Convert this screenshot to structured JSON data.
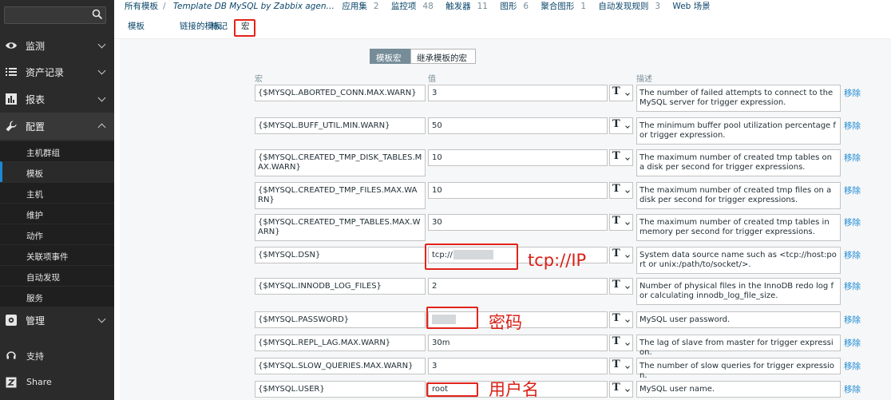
{
  "sidebar": {
    "search": {
      "value": "",
      "placeholder": ""
    },
    "menu": [
      {
        "label": "监测"
      },
      {
        "label": "资产记录"
      },
      {
        "label": "报表"
      },
      {
        "label": "配置"
      },
      {
        "label": "管理"
      }
    ],
    "config_submenu": [
      "主机群组",
      "模板",
      "主机",
      "维护",
      "动作",
      "关联项事件",
      "自动发现",
      "服务"
    ],
    "bottom": [
      {
        "label": "支持"
      },
      {
        "label": "Share"
      }
    ]
  },
  "breadcrumb": {
    "all_templates": "所有模板",
    "separator": "/",
    "template_name": "Template DB MySQL by Zabbix agen…",
    "applications": "应用集",
    "applications_count": "2",
    "items": "监控项",
    "items_count": "48",
    "triggers": "触发器",
    "triggers_count": "11",
    "graphs": "图形",
    "graphs_count": "6",
    "aggregate_graphs": "聚合图形",
    "aggregate_graphs_count": "1",
    "discovery": "自动发现规则",
    "discovery_count": "3",
    "web": "Web 场景"
  },
  "tabs": [
    "模板",
    "链接的模板",
    "标记",
    "宏"
  ],
  "subtabs": {
    "template_macros": "模板宏",
    "inherited_macros": "继承模板的宏"
  },
  "columns": {
    "macro": "宏",
    "value": "值",
    "description": "描述"
  },
  "remove_label": "移除",
  "macros": [
    {
      "macro": "{$MYSQL.ABORTED_CONN.MAX.WARN}",
      "value": "3",
      "description": "The number of failed attempts to connect to the MySQL server for trigger expression."
    },
    {
      "macro": "{$MYSQL.BUFF_UTIL.MIN.WARN}",
      "value": "50",
      "description": "The minimum buffer pool utilization percentage for trigger expression."
    },
    {
      "macro": "{$MYSQL.CREATED_TMP_DISK_TABLES.MAX.WARN}",
      "value": "10",
      "description": "The maximum number of created tmp tables on a disk per second for trigger expressions."
    },
    {
      "macro": "{$MYSQL.CREATED_TMP_FILES.MAX.WARN}",
      "value": "10",
      "description": "The maximum number of created tmp files on a disk per second for trigger expressions."
    },
    {
      "macro": "{$MYSQL.CREATED_TMP_TABLES.MAX.WARN}",
      "value": "30",
      "description": "The maximum number of created tmp tables in memory per second for trigger expressions."
    },
    {
      "macro": "{$MYSQL.DSN}",
      "value": "tcp://1          19",
      "description": "System data source name such as <tcp://host:port or unix:/path/to/socket/>."
    },
    {
      "macro": "{$MYSQL.INNODB_LOG_FILES}",
      "value": "2",
      "description": "Number of physical files in the InnoDB redo log for calculating innodb_log_file_size."
    },
    {
      "macro": "{$MYSQL.PASSWORD}",
      "value": "",
      "description": "MySQL user password."
    },
    {
      "macro": "{$MYSQL.REPL_LAG.MAX.WARN}",
      "value": "30m",
      "description": "The lag of slave from master for trigger expression."
    },
    {
      "macro": "{$MYSQL.SLOW_QUERIES.MAX.WARN}",
      "value": "3",
      "description": "The number of slow queries for trigger expression."
    },
    {
      "macro": "{$MYSQL.USER}",
      "value": "root",
      "description": "MySQL user name."
    }
  ],
  "type_button_glyph": "T",
  "annotations": {
    "dsn": "tcp://IP",
    "password": "密码",
    "user": "用户名"
  },
  "colors": {
    "sidebar_bg": "#2b2b2b",
    "link": "#1a8ad4",
    "annotation": "#e3231a",
    "active_subtab": "#768d99"
  }
}
